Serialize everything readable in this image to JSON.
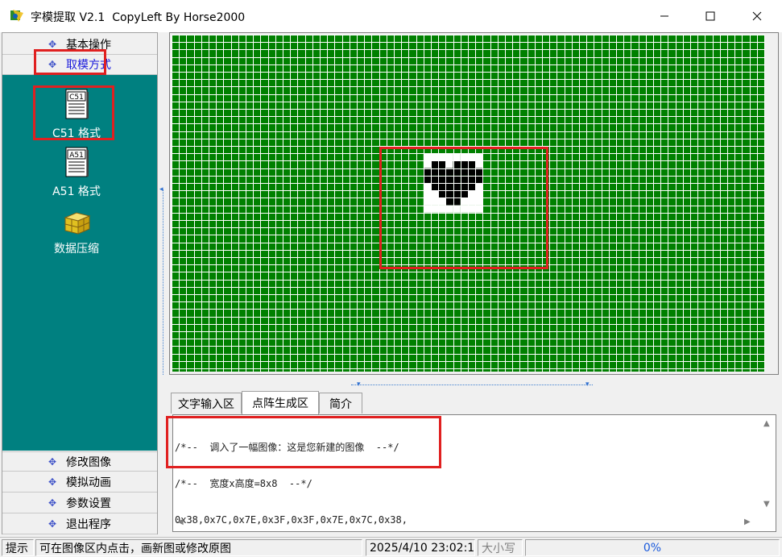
{
  "window": {
    "title": "字模提取 V2.1  CopyLeft By Horse2000",
    "minimize_icon": "minimize-icon",
    "maximize_icon": "maximize-icon",
    "close_icon": "close-icon"
  },
  "sidebar": {
    "top_categories": [
      {
        "label": "基本操作",
        "active": false
      },
      {
        "label": "取模方式",
        "active": true
      }
    ],
    "tools": [
      {
        "label": "C51 格式",
        "icon": "c51-document-icon",
        "badge": "C51"
      },
      {
        "label": "A51 格式",
        "icon": "a51-document-icon",
        "badge": "A51"
      },
      {
        "label": "数据压缩",
        "icon": "data-compress-icon"
      }
    ],
    "bottom_categories": [
      {
        "label": "修改图像"
      },
      {
        "label": "模拟动画"
      },
      {
        "label": "参数设置"
      },
      {
        "label": "退出程序"
      }
    ]
  },
  "canvas": {
    "grid_color": "#008000",
    "line_color": "#ffffff",
    "bitmap_bytes": [
      "0x38",
      "0x7C",
      "0x7E",
      "0x3F",
      "0x3F",
      "0x7E",
      "0x7C",
      "0x38"
    ],
    "bitmap_rows": [
      "........",
      ".##.###.",
      "########",
      "########",
      ".######.",
      "..####..",
      "...##...",
      "........"
    ]
  },
  "tabs": [
    {
      "label": "文字输入区",
      "active": false
    },
    {
      "label": "点阵生成区",
      "active": true
    },
    {
      "label": "简介",
      "active": false
    }
  ],
  "output": {
    "lines": [
      "/*--  调入了一幅图像：这是您新建的图像  --*/",
      "/*--  宽度x高度=8x8  --*/",
      "0x38,0x7C,0x7E,0x3F,0x3F,0x7E,0x7C,0x38,"
    ]
  },
  "statusbar": {
    "label": "提示",
    "message": "可在图像区内点击，画新图或修改原图",
    "datetime": "2025/4/10 23:02:13",
    "caps": "大小写",
    "progress_text": "0%",
    "progress": 0
  },
  "colors": {
    "teal_panel": "#008080",
    "highlight_box": "#e02020",
    "grid_green": "#008000"
  }
}
